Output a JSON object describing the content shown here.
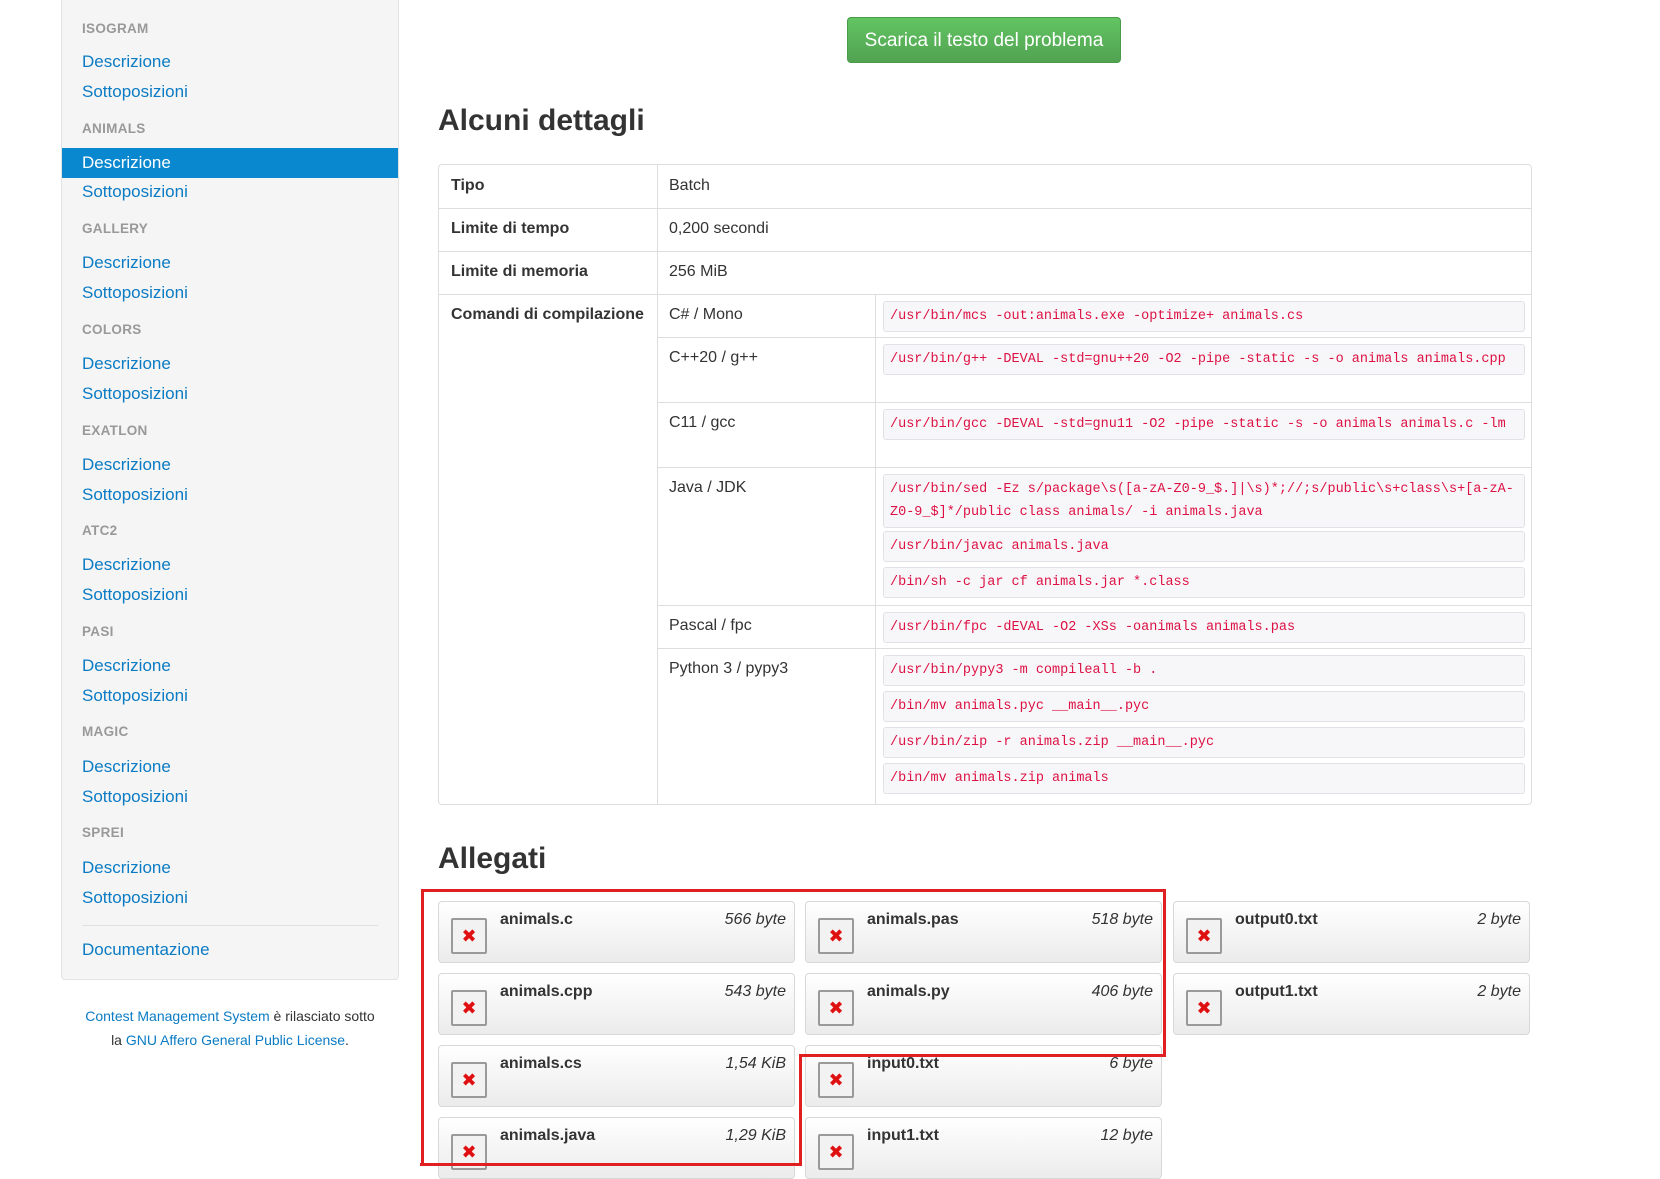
{
  "sidebar": {
    "sections": [
      {
        "header": "ISOGRAM",
        "links": [
          "Descrizione",
          "Sottoposizioni"
        ]
      },
      {
        "header": "ANIMALS",
        "links": [
          "Descrizione",
          "Sottoposizioni"
        ]
      },
      {
        "header": "GALLERY",
        "links": [
          "Descrizione",
          "Sottoposizioni"
        ]
      },
      {
        "header": "COLORS",
        "links": [
          "Descrizione",
          "Sottoposizioni"
        ]
      },
      {
        "header": "EXATLON",
        "links": [
          "Descrizione",
          "Sottoposizioni"
        ]
      },
      {
        "header": "ATC2",
        "links": [
          "Descrizione",
          "Sottoposizioni"
        ]
      },
      {
        "header": "PASI",
        "links": [
          "Descrizione",
          "Sottoposizioni"
        ]
      },
      {
        "header": "MAGIC",
        "links": [
          "Descrizione",
          "Sottoposizioni"
        ]
      },
      {
        "header": "SPREI",
        "links": [
          "Descrizione",
          "Sottoposizioni"
        ]
      }
    ],
    "active_section": "ANIMALS",
    "active_link": "Descrizione",
    "doc_link": "Documentazione"
  },
  "footer": {
    "cms_link": "Contest Management System",
    "text_mid": " è rilasciato sotto",
    "text_la": "la ",
    "license_link": "GNU Affero General Public License",
    "text_end": "."
  },
  "download_button": "Scarica il testo del problema",
  "details": {
    "title": "Alcuni dettagli",
    "rows": [
      {
        "label": "Tipo",
        "value": "Batch"
      },
      {
        "label": "Limite di tempo",
        "value": "0,200 secondi"
      },
      {
        "label": "Limite di memoria",
        "value": "256 MiB"
      }
    ],
    "compile_label": "Comandi di compilazione",
    "languages": [
      {
        "name": "C# / Mono",
        "commands": [
          "/usr/bin/mcs -out:animals.exe -optimize+ animals.cs"
        ]
      },
      {
        "name": "C++20 / g++",
        "commands": [
          "/usr/bin/g++ -DEVAL -std=gnu++20 -O2 -pipe -static -s -o animals animals.cpp"
        ]
      },
      {
        "name": "C11 / gcc",
        "commands": [
          "/usr/bin/gcc -DEVAL -std=gnu11 -O2 -pipe -static -s -o animals animals.c -lm"
        ]
      },
      {
        "name": "Java / JDK",
        "commands": [
          "/usr/bin/sed -Ez s/package\\s([a-zA-Z0-9_$.]|\\s)*;//;s/public\\s+class\\s+[a-zA-Z0-9_$]*/public class animals/ -i animals.java",
          "/usr/bin/javac animals.java",
          "/bin/sh -c jar cf animals.jar *.class"
        ]
      },
      {
        "name": "Pascal / fpc",
        "commands": [
          "/usr/bin/fpc -dEVAL -O2 -XSs -oanimals animals.pas"
        ]
      },
      {
        "name": "Python 3 / pypy3",
        "commands": [
          "/usr/bin/pypy3 -m compileall -b .",
          "/bin/mv animals.pyc __main__.pyc",
          "/usr/bin/zip -r animals.zip __main__.pyc",
          "/bin/mv animals.zip animals"
        ]
      }
    ]
  },
  "attachments": {
    "title": "Allegati",
    "items": [
      {
        "name": "animals.c",
        "size": "566 byte"
      },
      {
        "name": "animals.cpp",
        "size": "543 byte"
      },
      {
        "name": "animals.cs",
        "size": "1,54 KiB"
      },
      {
        "name": "animals.java",
        "size": "1,29 KiB"
      },
      {
        "name": "animals.pas",
        "size": "518 byte"
      },
      {
        "name": "animals.py",
        "size": "406 byte"
      },
      {
        "name": "input0.txt",
        "size": "6 byte"
      },
      {
        "name": "input1.txt",
        "size": "12 byte"
      },
      {
        "name": "output0.txt",
        "size": "2 byte"
      },
      {
        "name": "output1.txt",
        "size": "2 byte"
      }
    ],
    "icon": "broken-image-icon"
  },
  "colors": {
    "link": "#0a7bc4",
    "active": "#0a88cf",
    "button": "#5cb85c",
    "code": "#d14",
    "annotation": "#e02020"
  }
}
